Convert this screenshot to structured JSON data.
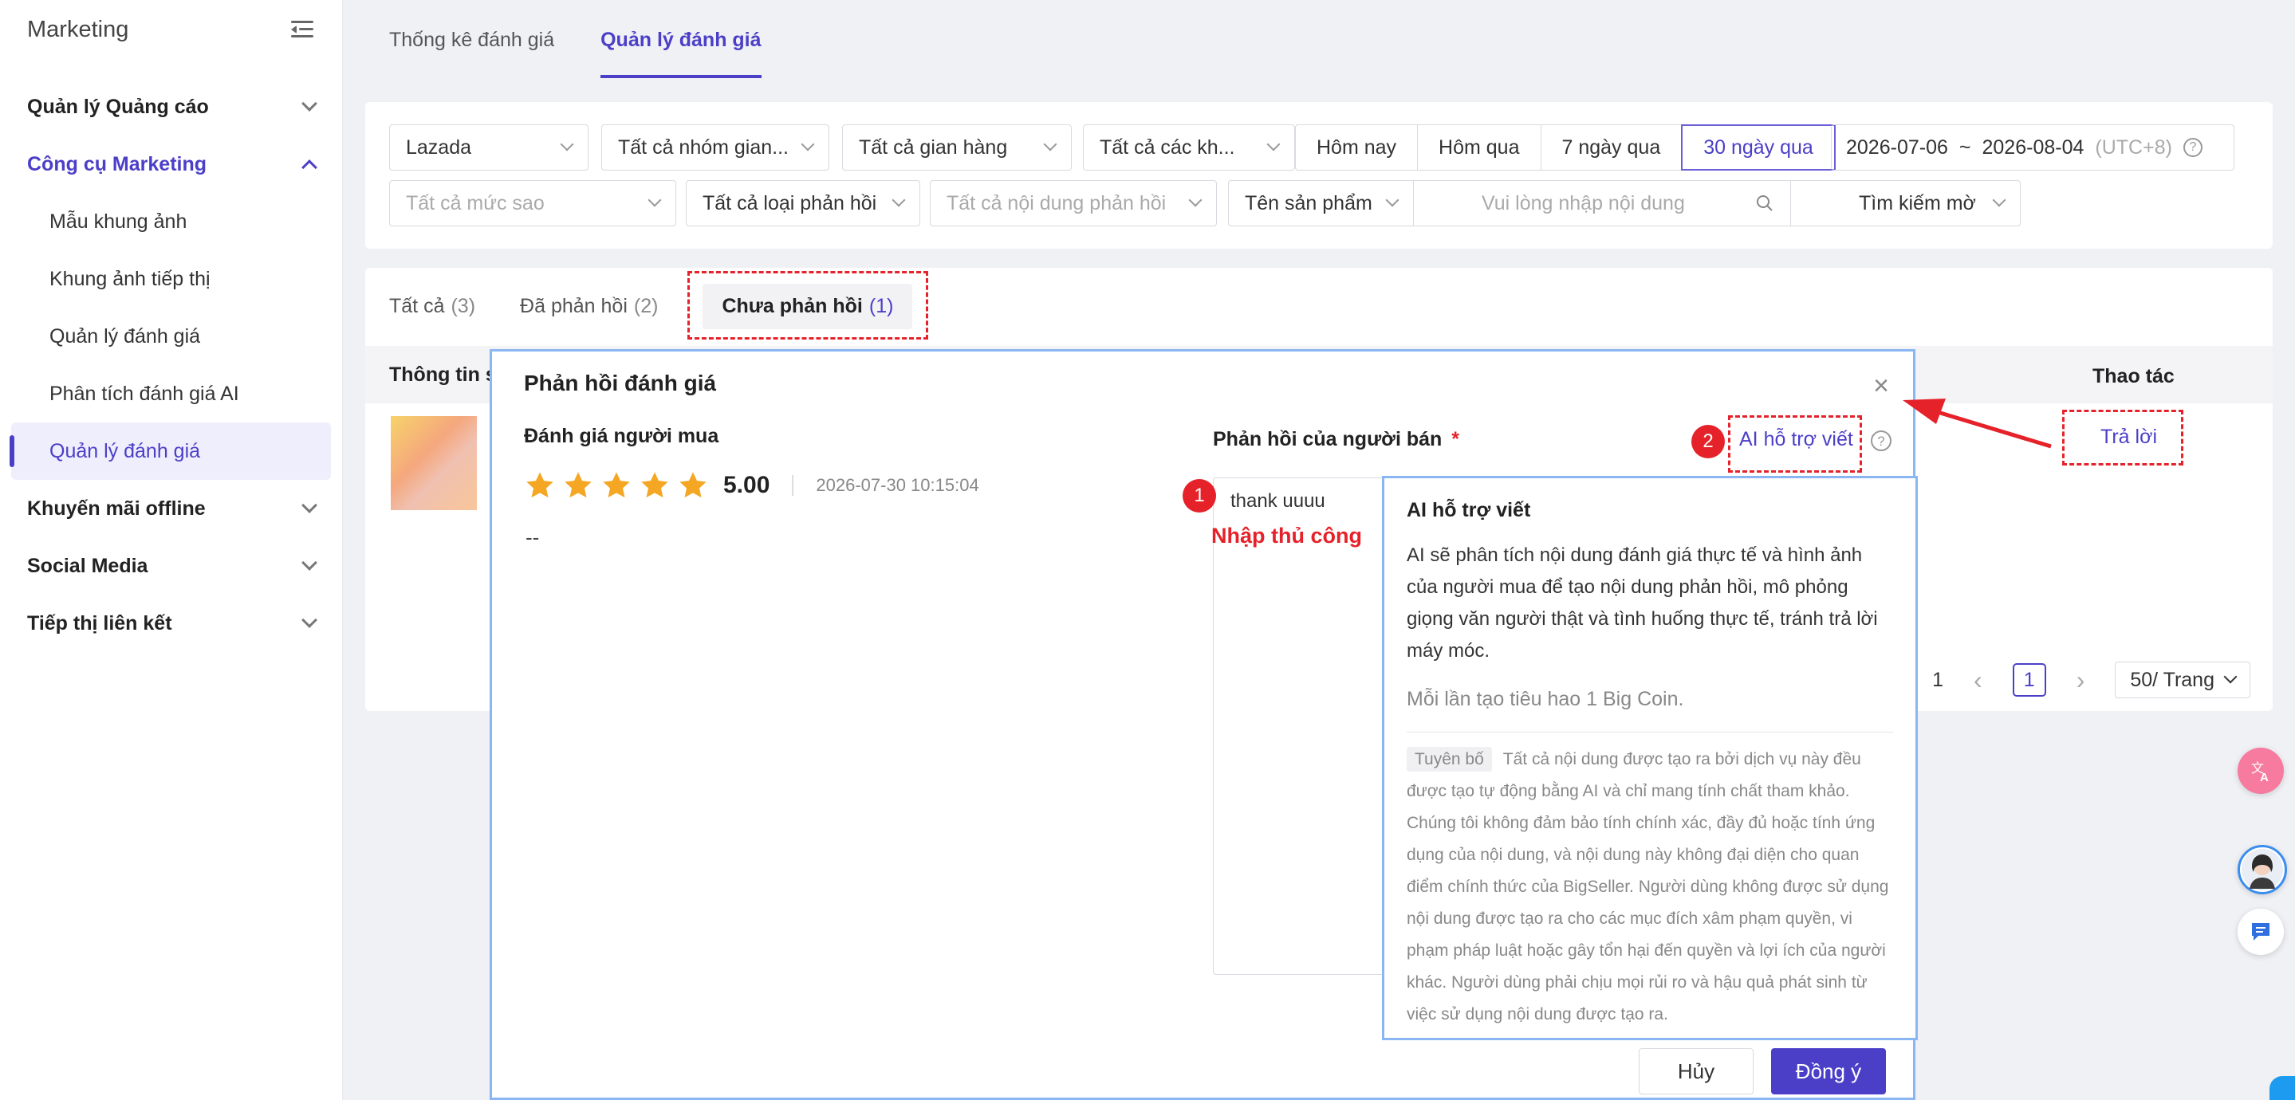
{
  "sidebar": {
    "title": "Marketing",
    "items": [
      {
        "label": "Quản lý Quảng cáo"
      },
      {
        "label": "Công cụ Marketing"
      },
      {
        "label": "Khuyến mãi offline"
      },
      {
        "label": "Social Media"
      },
      {
        "label": "Tiếp thị liên kết"
      }
    ],
    "sub_items": [
      {
        "label": "Mẫu khung ảnh"
      },
      {
        "label": "Khung ảnh tiếp thị"
      },
      {
        "label": "Quản lý đánh giá"
      },
      {
        "label": "Phân tích đánh giá AI"
      },
      {
        "label": "Quản lý đánh giá"
      }
    ]
  },
  "top_tabs": [
    {
      "label": "Thống kê đánh giá"
    },
    {
      "label": "Quản lý đánh giá"
    }
  ],
  "filters": {
    "platform": "Lazada",
    "store_group": "Tất cả nhóm gian...",
    "store": "Tất cả gian hàng",
    "customer": "Tất cả các kh...",
    "periods": [
      "Hôm nay",
      "Hôm qua",
      "7 ngày qua",
      "30 ngày qua"
    ],
    "date_start": "2026-07-06",
    "date_sep": "~",
    "date_end": "2026-08-04",
    "timezone": "(UTC+8)",
    "stars": "Tất cả mức sao",
    "reply_type": "Tất cả loại phản hồi",
    "reply_content": "Tất cả nội dung phản hồi",
    "search_field": "Tên sản phẩm",
    "search_placeholder": "Vui lòng nhập nội dung",
    "search_mode": "Tìm kiếm mờ"
  },
  "list_tabs": [
    {
      "label": "Tất cả",
      "count": "(3)"
    },
    {
      "label": "Đã phản hồi",
      "count": "(2)"
    },
    {
      "label": "Chưa phản hồi",
      "count": "(1)"
    }
  ],
  "table": {
    "col_product": "Thông tin s",
    "col_ops": "Thao tác",
    "reply_action": "Trả lời"
  },
  "pager": {
    "total": "1",
    "prev": "‹",
    "current": "1",
    "next": "›",
    "page_size": "50/ Trang"
  },
  "modal": {
    "title": "Phản hồi đánh giá",
    "close": "×",
    "buyer_label": "Đánh giá người mua",
    "rating": "5.00",
    "review_date": "2026-07-30 10:15:04",
    "review_text": "--",
    "seller_label": "Phản hồi của người bán",
    "required_mark": "*",
    "reply_value": "thank uuuu",
    "ai_link": "AI hỗ trợ viết",
    "cancel": "Hủy",
    "ok": "Đồng ý"
  },
  "annotations": {
    "badge1": "1",
    "badge2": "2",
    "manual_label": "Nhập thủ công"
  },
  "tooltip": {
    "title": "AI hỗ trợ viết",
    "body": "AI sẽ phân tích nội dung đánh giá thực tế và hình ảnh của người mua để tạo nội dung phản hồi, mô phỏng giọng văn người thật và tình huống thực tế, tránh trả lời máy móc.",
    "cost": "Mỗi lần tạo tiêu hao 1 Big Coin.",
    "disclaimer_tag": "Tuyên bố",
    "disclaimer": "Tất cả nội dung được tạo ra bởi dịch vụ này đều được tạo tự động bằng AI và chỉ mang tính chất tham khảo. Chúng tôi không đảm bảo tính chính xác, đầy đủ hoặc tính ứng dụng của nội dung, và nội dung này không đại diện cho quan điểm chính thức của BigSeller. Người dùng không được sử dụng nội dung được tạo ra cho các mục đích xâm phạm quyền, vi phạm pháp luật hoặc gây tổn hại đến quyền và lợi ích của người khác. Người dùng phải chịu mọi rủi ro và hậu quả phát sinh từ việc sử dụng nội dung được tạo ra."
  },
  "colors": {
    "accent": "#4b3fc8",
    "annotation_red": "#e5222a",
    "star": "#f5a623"
  }
}
